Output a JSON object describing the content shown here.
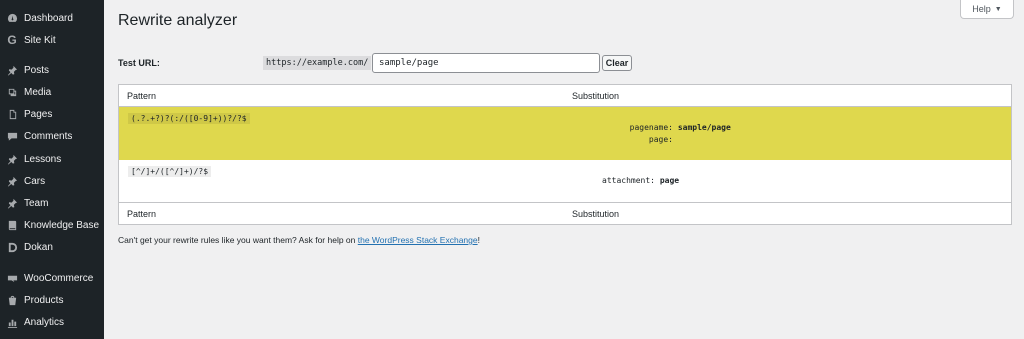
{
  "sidebar": {
    "items": [
      {
        "label": "Dashboard",
        "icon": "dashboard-icon"
      },
      {
        "label": "Site Kit",
        "icon": "site-kit-icon"
      },
      {
        "label": "Posts",
        "icon": "pin-icon"
      },
      {
        "label": "Media",
        "icon": "media-icon"
      },
      {
        "label": "Pages",
        "icon": "pages-icon"
      },
      {
        "label": "Comments",
        "icon": "comments-icon"
      },
      {
        "label": "Lessons",
        "icon": "pin-icon"
      },
      {
        "label": "Cars",
        "icon": "pin-icon"
      },
      {
        "label": "Team",
        "icon": "pin-icon"
      },
      {
        "label": "Knowledge Base",
        "icon": "book-icon"
      },
      {
        "label": "Dokan",
        "icon": "dokan-icon"
      },
      {
        "label": "WooCommerce",
        "icon": "woocommerce-icon"
      },
      {
        "label": "Products",
        "icon": "products-icon"
      },
      {
        "label": "Analytics",
        "icon": "analytics-icon"
      }
    ]
  },
  "header": {
    "help_label": "Help",
    "title": "Rewrite analyzer"
  },
  "test_url": {
    "label": "Test URL:",
    "base": "https://example.com/",
    "value": "sample/page",
    "clear_label": "Clear"
  },
  "table": {
    "columns": [
      "Pattern",
      "Substitution"
    ],
    "rows": [
      {
        "pattern": "(.?.+?)?(:/([0-9]+))?/?$",
        "matched": true,
        "substitutions": [
          {
            "key": "pagename:",
            "value": "sample/page"
          },
          {
            "key": "page:",
            "value": ""
          }
        ]
      },
      {
        "pattern": "[^/]+/([^/]+)/?$",
        "matched": false,
        "substitutions": [
          {
            "key": "attachment:",
            "value": "page"
          }
        ]
      }
    ]
  },
  "help": {
    "text": "Can't get your rewrite rules like you want them? Ask for help on ",
    "link": "the WordPress Stack Exchange",
    "end": "!"
  },
  "colors": {
    "sidebar_bg": "#1d2327",
    "match_highlight": "#dfd84d",
    "link": "#2271b1"
  }
}
